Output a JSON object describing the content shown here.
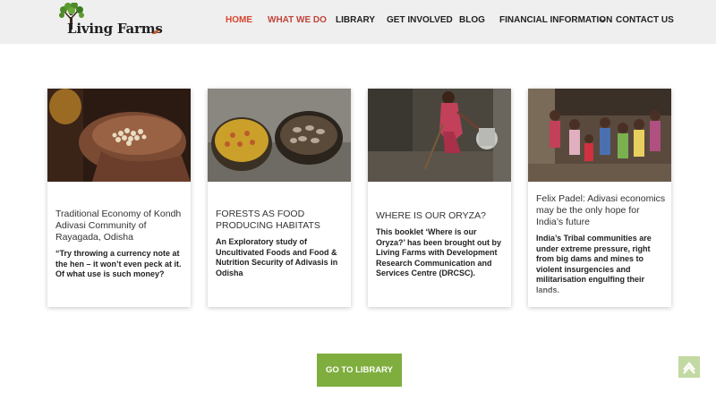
{
  "brand": {
    "name": "Living Farms"
  },
  "nav": {
    "items": [
      {
        "label": "HOME"
      },
      {
        "label": "WHAT WE DO"
      },
      {
        "label": "LIBRARY"
      },
      {
        "label": "GET INVOLVED"
      },
      {
        "label": "BLOG"
      },
      {
        "label": "FINANCIAL INFORMATION"
      },
      {
        "label": "CONTACT US"
      }
    ]
  },
  "cards": [
    {
      "title": "Traditional Economy of Kondh Adivasi Community of Rayagada, Odisha",
      "excerpt": "“Try throwing a currency note at the hen – it won’t even peck at it. Of what use is such money?"
    },
    {
      "title": "FORESTS AS FOOD PRODUCING HABITATS",
      "excerpt": "An Exploratory study of Uncultivated Foods and Food & Nutrition Security of Adivasis in Odisha"
    },
    {
      "title": "WHERE IS OUR ORYZA?",
      "excerpt": "This booklet ‘Where is our Oryza?’ has been brought out by Living Farms with Development Research Communication and Services Centre (DRCSC)."
    },
    {
      "title": "Felix Padel: Adivasi economics may be the only hope for India’s future",
      "excerpt": "India’s Tribal communities are under extreme pressure, right from big dams and mines to violent insurgencies and militarisation engulfing their lands."
    }
  ],
  "cta": {
    "label": "GO TO LIBRARY"
  },
  "icons": {
    "chevron": "chevron-down-icon",
    "to_top": "arrow-up-icon",
    "logo": "tree-icon"
  },
  "colors": {
    "active_nav": "#d9452c",
    "button": "#7fae3e",
    "header_bg": "#efefef"
  }
}
